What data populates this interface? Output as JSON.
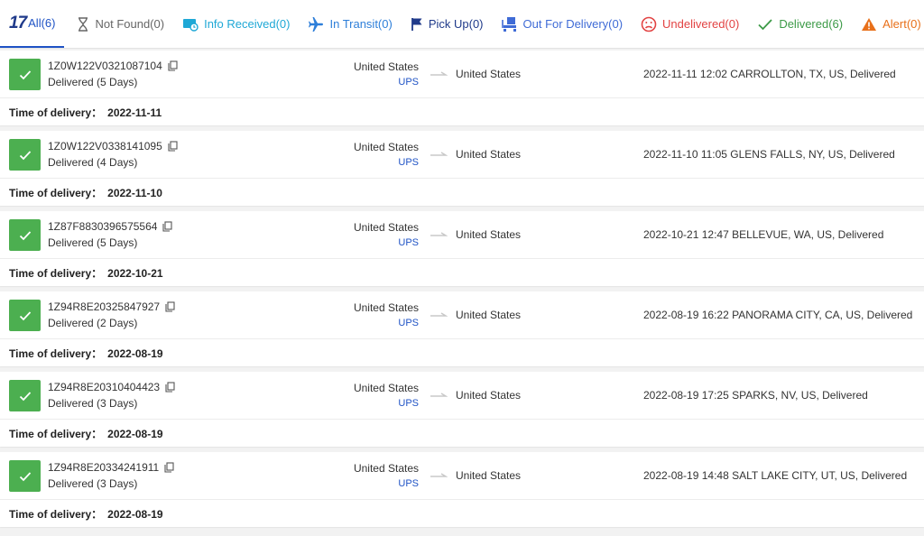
{
  "tabs": {
    "all": {
      "logo": "17",
      "label": "All(6)"
    },
    "not_found": {
      "label": "Not Found(0)"
    },
    "info_received": {
      "label": "Info Received(0)"
    },
    "in_transit": {
      "label": "In Transit(0)"
    },
    "pick_up": {
      "label": "Pick Up(0)"
    },
    "out_for_delivery": {
      "label": "Out For Delivery(0)"
    },
    "undelivered": {
      "label": "Undelivered(0)"
    },
    "delivered": {
      "label": "Delivered(6)"
    },
    "alert": {
      "label": "Alert(0)"
    }
  },
  "delivery_label": "Time of delivery：",
  "shipments": [
    {
      "tracking": "1Z0W122V0321087104",
      "status": "Delivered (5 Days)",
      "origin": "United States",
      "carrier": "UPS",
      "destination": "United States",
      "event": "2022-11-11 12:02  CARROLLTON, TX, US, Delivered",
      "delivery_date": "2022-11-11"
    },
    {
      "tracking": "1Z0W122V0338141095",
      "status": "Delivered (4 Days)",
      "origin": "United States",
      "carrier": "UPS",
      "destination": "United States",
      "event": "2022-11-10 11:05  GLENS FALLS, NY, US, Delivered",
      "delivery_date": "2022-11-10"
    },
    {
      "tracking": "1Z87F8830396575564",
      "status": "Delivered (5 Days)",
      "origin": "United States",
      "carrier": "UPS",
      "destination": "United States",
      "event": "2022-10-21 12:47  BELLEVUE, WA, US, Delivered",
      "delivery_date": "2022-10-21"
    },
    {
      "tracking": "1Z94R8E20325847927",
      "status": "Delivered (2 Days)",
      "origin": "United States",
      "carrier": "UPS",
      "destination": "United States",
      "event": "2022-08-19 16:22  PANORAMA CITY, CA, US, Delivered",
      "delivery_date": "2022-08-19"
    },
    {
      "tracking": "1Z94R8E20310404423",
      "status": "Delivered (3 Days)",
      "origin": "United States",
      "carrier": "UPS",
      "destination": "United States",
      "event": "2022-08-19 17:25  SPARKS, NV, US, Delivered",
      "delivery_date": "2022-08-19"
    },
    {
      "tracking": "1Z94R8E20334241911",
      "status": "Delivered (3 Days)",
      "origin": "United States",
      "carrier": "UPS",
      "destination": "United States",
      "event": "2022-08-19 14:48  SALT LAKE CITY, UT, US, Delivered",
      "delivery_date": "2022-08-19"
    }
  ]
}
